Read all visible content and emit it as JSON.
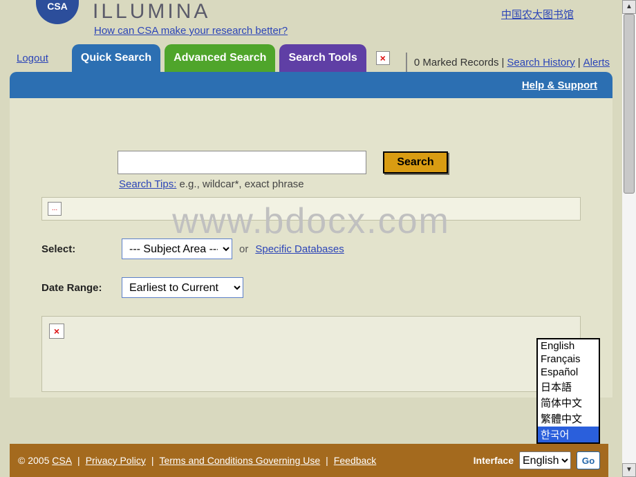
{
  "header": {
    "logo_abbrev": "CSA",
    "logo_text": "ILLUMINA",
    "chinese_library": "中国农大图书馆",
    "promo_link": "How can CSA make your research better?",
    "logout": "Logout",
    "tabs": {
      "quick": "Quick Search",
      "advanced": "Advanced Search",
      "tools": "Search Tools"
    },
    "broken_glyph": "×",
    "marked_records": "0 Marked Records",
    "search_history": "Search History",
    "alerts": "Alerts",
    "help_support": "Help & Support"
  },
  "search": {
    "button": "Search",
    "tips_label": "Search Tips:",
    "tips_example": "e.g., wildcar*, exact phrase",
    "small_glyph": "..."
  },
  "watermark": "www.bdocx.com",
  "select_row": {
    "label": "Select:",
    "subject_area": "--- Subject Area ---",
    "or": "or",
    "specific_db": "Specific Databases"
  },
  "date_row": {
    "label": "Date Range:",
    "range": "Earliest to Current"
  },
  "broken_x": "×",
  "lang_popup": {
    "options": [
      "English",
      "Français",
      "Español",
      "日本語",
      "简体中文",
      "繁體中文",
      "한국어"
    ],
    "selected_index": 6
  },
  "footer": {
    "copyright": "© 2005",
    "csa": "CSA",
    "privacy": "Privacy Policy",
    "terms": "Terms and Conditions Governing Use",
    "feedback": "Feedback",
    "interface_label": "Interface",
    "interface_value": "English",
    "go": "Go"
  }
}
